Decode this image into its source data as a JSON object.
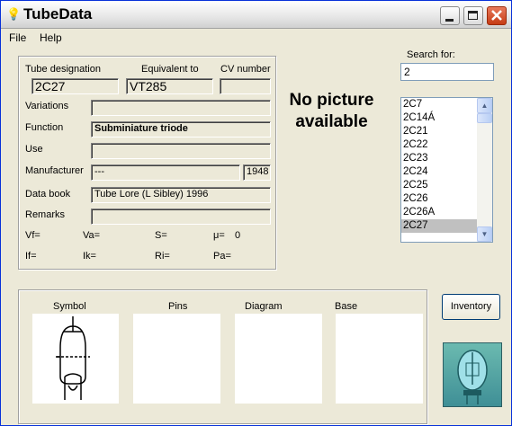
{
  "window": {
    "title": "TubeData",
    "title_icon": "lightbulb-icon"
  },
  "menu": {
    "file": "File",
    "help": "Help"
  },
  "details": {
    "designation_label": "Tube designation",
    "equivalent_label": "Equivalent to",
    "cv_label": "CV number",
    "designation_value": "2C27",
    "equivalent_value": "VT285",
    "cv_value": "",
    "variations_label": "Variations",
    "variations_value": "",
    "function_label": "Function",
    "function_value": "Subminiature triode",
    "use_label": "Use",
    "use_value": "",
    "manufacturer_label": "Manufacturer",
    "manufacturer_value": "---",
    "year_value": "1948",
    "databook_label": "Data book",
    "databook_value": "Tube Lore (L Sibley) 1996",
    "remarks_label": "Remarks",
    "remarks_value": "",
    "vf": "Vf=",
    "va": "Va=",
    "s": "S=",
    "mu": "μ=",
    "mu_value": "0",
    "if": "If=",
    "ik": "Ik=",
    "ri": "Ri=",
    "pa": "Pa="
  },
  "picture": {
    "no_picture_text": "No picture available"
  },
  "search": {
    "label": "Search for:",
    "value": "2",
    "list": [
      "2C7",
      "2C14Á",
      "2C21",
      "2C22",
      "2C23",
      "2C24",
      "2C25",
      "2C26",
      "2C26A",
      "2C27"
    ],
    "selected": "2C27"
  },
  "bottom": {
    "symbol": "Symbol",
    "pins": "Pins",
    "diagram": "Diagram",
    "base": "Base"
  },
  "buttons": {
    "inventory": "Inventory"
  },
  "colors": {
    "window_bg": "#ece9d8",
    "titlebar_close": "#c63b14",
    "list_selected": "#c0c0c0"
  }
}
